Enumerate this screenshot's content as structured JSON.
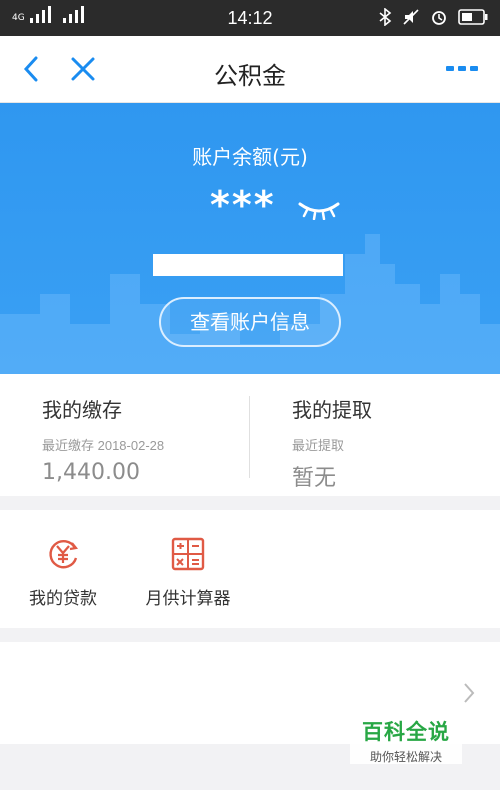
{
  "status_bar": {
    "network_label": "4G",
    "time": "14:12",
    "icons": [
      "bluetooth-icon",
      "mute-icon",
      "alarm-icon",
      "battery-icon"
    ]
  },
  "nav": {
    "title": "公积金",
    "back_icon": "chevron-left-icon",
    "close_icon": "close-icon",
    "more_icon": "more-dots-icon"
  },
  "account": {
    "balance_label": "账户余额(元)",
    "balance_masked": "***",
    "eye_icon": "eye-closed-icon",
    "view_info_button": "查看账户信息"
  },
  "stats": {
    "deposit": {
      "title": "我的缴存",
      "subtitle": "最近缴存 2018-02-28",
      "value": "1,440.00"
    },
    "withdraw": {
      "title": "我的提取",
      "subtitle": "最近提取",
      "value": "暂无"
    }
  },
  "tools": [
    {
      "label": "我的贷款",
      "icon": "yen-loan-icon"
    },
    {
      "label": "月供计算器",
      "icon": "calculator-icon"
    }
  ],
  "watermark": {
    "title": "百科全说",
    "subtitle": "助你轻松解决"
  },
  "colors": {
    "primary": "#2f97f0",
    "accent_red": "#e05a45",
    "watermark_green": "#28a745"
  }
}
